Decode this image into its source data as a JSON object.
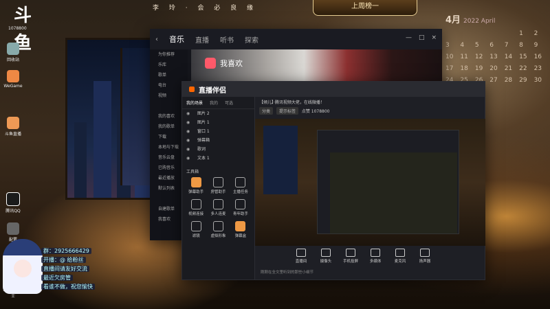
{
  "desktop": {
    "logo_text": "斗鱼",
    "logo_sub": "1078800",
    "header_deco": "李 玲  ·  会 必 良 缘",
    "badge": "上周榜一",
    "calendar": {
      "month": "4月",
      "year_label": "2022 April",
      "days": [
        "",
        "",
        "",
        "",
        "",
        "1",
        "2",
        "3",
        "4",
        "5",
        "6",
        "7",
        "8",
        "9",
        "10",
        "11",
        "12",
        "13",
        "14",
        "15",
        "16",
        "17",
        "18",
        "19",
        "20",
        "21",
        "22",
        "23",
        "24",
        "25",
        "26",
        "27",
        "28",
        "29",
        "30"
      ]
    },
    "icons": [
      {
        "label": "回收站",
        "color": "#8aa"
      },
      {
        "label": "WeGame",
        "color": "#e84"
      },
      {
        "label": "斗鱼直播",
        "color": "#e95"
      },
      {
        "label": "腾讯QQ",
        "color": "#1b1b1b"
      },
      {
        "label": "配置",
        "color": "#666"
      },
      {
        "label": "360安全卫士",
        "color": "#3b7"
      }
    ],
    "qq_lines": [
      "群：2925666429",
      "开播：@ 给粉丝",
      "直播间请友好交流",
      "最近欠房管",
      "看谁不做，祝您愉快"
    ]
  },
  "music": {
    "nav": [
      "音乐",
      "直播",
      "听书",
      "探索"
    ],
    "active_nav": 0,
    "sidebar": [
      "为你推荐",
      "乐库",
      "歌单",
      "电台",
      "视频",
      "",
      "我的喜欢",
      "我的歌单",
      "下载",
      "本地与下载",
      "音乐云盘",
      "已购音乐",
      "最近播放",
      "默认列表",
      "",
      "自建歌单",
      "我喜欢"
    ],
    "love_title": "我喜欢",
    "window_controls": [
      "—",
      "□",
      "×"
    ]
  },
  "zb": {
    "title": "直播伴侣",
    "tabs": [
      "我的场景",
      "我的",
      "可选"
    ],
    "active_tab": 0,
    "scenes": [
      "图片 2",
      "图片 1",
      "窗口 1",
      "弹幕箱",
      "歌词",
      "文本 1"
    ],
    "tools_title": "工具箱",
    "tools": [
      {
        "label": "弹幕助手",
        "hl": true
      },
      {
        "label": "房管助手",
        "hl": false
      },
      {
        "label": "主播任务",
        "hl": false
      },
      {
        "label": "视频连接",
        "hl": false
      },
      {
        "label": "多人连麦",
        "hl": false
      },
      {
        "label": "青年助手",
        "hl": false
      },
      {
        "label": "滤镜",
        "hl": false
      },
      {
        "label": "虚拟形象",
        "hl": false
      },
      {
        "label": "弹幕盒",
        "hl": true
      }
    ],
    "stream_title": "【倾儿】·腾讯视频大佬，在线微播！",
    "chips": [
      "分类",
      "提示标签"
    ],
    "stats": "点赞 1078800",
    "bottom": [
      "直播间",
      "摄像头",
      "手机投屏",
      "多媒体",
      "麦克风",
      "扬声器"
    ],
    "hint": "刚刚在全文里听到的那些小细节"
  }
}
